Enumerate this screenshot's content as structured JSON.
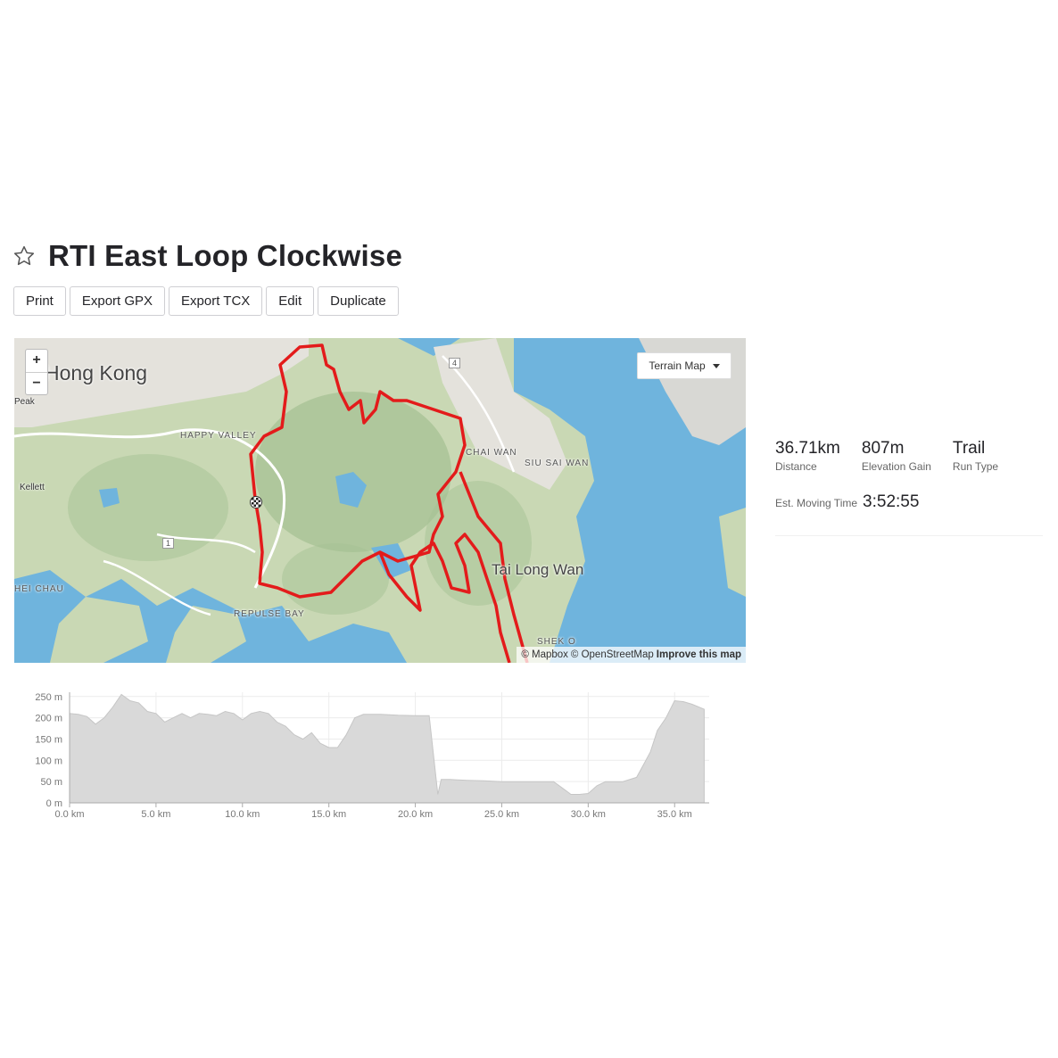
{
  "route": {
    "title": "RTI East Loop Clockwise"
  },
  "actions": {
    "print": "Print",
    "export_gpx": "Export GPX",
    "export_tcx": "Export TCX",
    "edit": "Edit",
    "duplicate": "Duplicate"
  },
  "map": {
    "zoom_in": "+",
    "zoom_out": "−",
    "style_selector": "Terrain Map",
    "labels": {
      "hong_kong": "Hong Kong",
      "peak": "Peak",
      "kellett": "Kellett",
      "happy_valley": "HAPPY VALLEY",
      "chai_wan": "CHAI WAN",
      "siu_sai_wan": "SIU SAI WAN",
      "tai_long_wan": "Tai Long Wan",
      "repulse_bay": "REPULSE BAY",
      "aberdeen": "HEI CHAU",
      "shek_o": "SHEK O",
      "road_1": "1",
      "road_4": "4"
    },
    "attribution": {
      "mapbox": "© Mapbox",
      "osm": "© OpenStreetMap",
      "improve": "Improve this map"
    },
    "colors": {
      "water": "#6fb4dd",
      "land": "#c9d8b4",
      "route": "#e31b1b"
    },
    "icons": {
      "start": "checkered-flag-icon",
      "zoom": "plus-minus-icon"
    }
  },
  "stats": {
    "distance": {
      "value": "36.71km",
      "label": "Distance"
    },
    "elevation_gain": {
      "value": "807m",
      "label": "Elevation Gain"
    },
    "run_type": {
      "value": "Trail",
      "label": "Run Type"
    },
    "moving_time": {
      "label": "Est. Moving Time",
      "value": "3:52:55"
    }
  },
  "chart_data": {
    "type": "area",
    "title": "",
    "xlabel": "",
    "ylabel": "",
    "xlim": [
      0,
      37
    ],
    "ylim": [
      0,
      260
    ],
    "x_ticks": [
      "0.0 km",
      "5.0 km",
      "10.0 km",
      "15.0 km",
      "20.0 km",
      "25.0 km",
      "30.0 km",
      "35.0 km"
    ],
    "x_tick_values": [
      0,
      5,
      10,
      15,
      20,
      25,
      30,
      35
    ],
    "y_ticks": [
      "0 m",
      "50 m",
      "100 m",
      "150 m",
      "200 m",
      "250 m"
    ],
    "y_tick_values": [
      0,
      50,
      100,
      150,
      200,
      250
    ],
    "grid": true,
    "fill_color": "#d9d9d9",
    "x": [
      0,
      0.5,
      1.0,
      1.5,
      2.0,
      2.5,
      3.0,
      3.5,
      4.0,
      4.5,
      5.0,
      5.5,
      6.0,
      6.5,
      7.0,
      7.5,
      8.0,
      8.5,
      9.0,
      9.5,
      10.0,
      10.5,
      11.0,
      11.5,
      12.0,
      12.5,
      13.0,
      13.5,
      14.0,
      14.5,
      15.0,
      15.5,
      16.0,
      16.5,
      17.0,
      18.0,
      19.0,
      20.0,
      20.8,
      21.3,
      21.5,
      22.0,
      23.0,
      24.0,
      25.0,
      26.0,
      27.0,
      28.0,
      28.5,
      29.0,
      29.5,
      30.0,
      30.5,
      31.0,
      32.0,
      32.8,
      33.2,
      33.6,
      34.0,
      34.5,
      35.0,
      35.5,
      36.0,
      36.71
    ],
    "y": [
      210,
      208,
      203,
      185,
      200,
      225,
      255,
      240,
      235,
      215,
      210,
      190,
      200,
      210,
      200,
      210,
      208,
      205,
      215,
      210,
      195,
      210,
      215,
      210,
      190,
      180,
      160,
      150,
      165,
      140,
      130,
      130,
      160,
      200,
      208,
      208,
      206,
      205,
      205,
      20,
      55,
      55,
      53,
      52,
      50,
      50,
      50,
      50,
      35,
      20,
      20,
      22,
      40,
      50,
      50,
      60,
      90,
      120,
      170,
      200,
      240,
      238,
      232,
      220
    ]
  }
}
